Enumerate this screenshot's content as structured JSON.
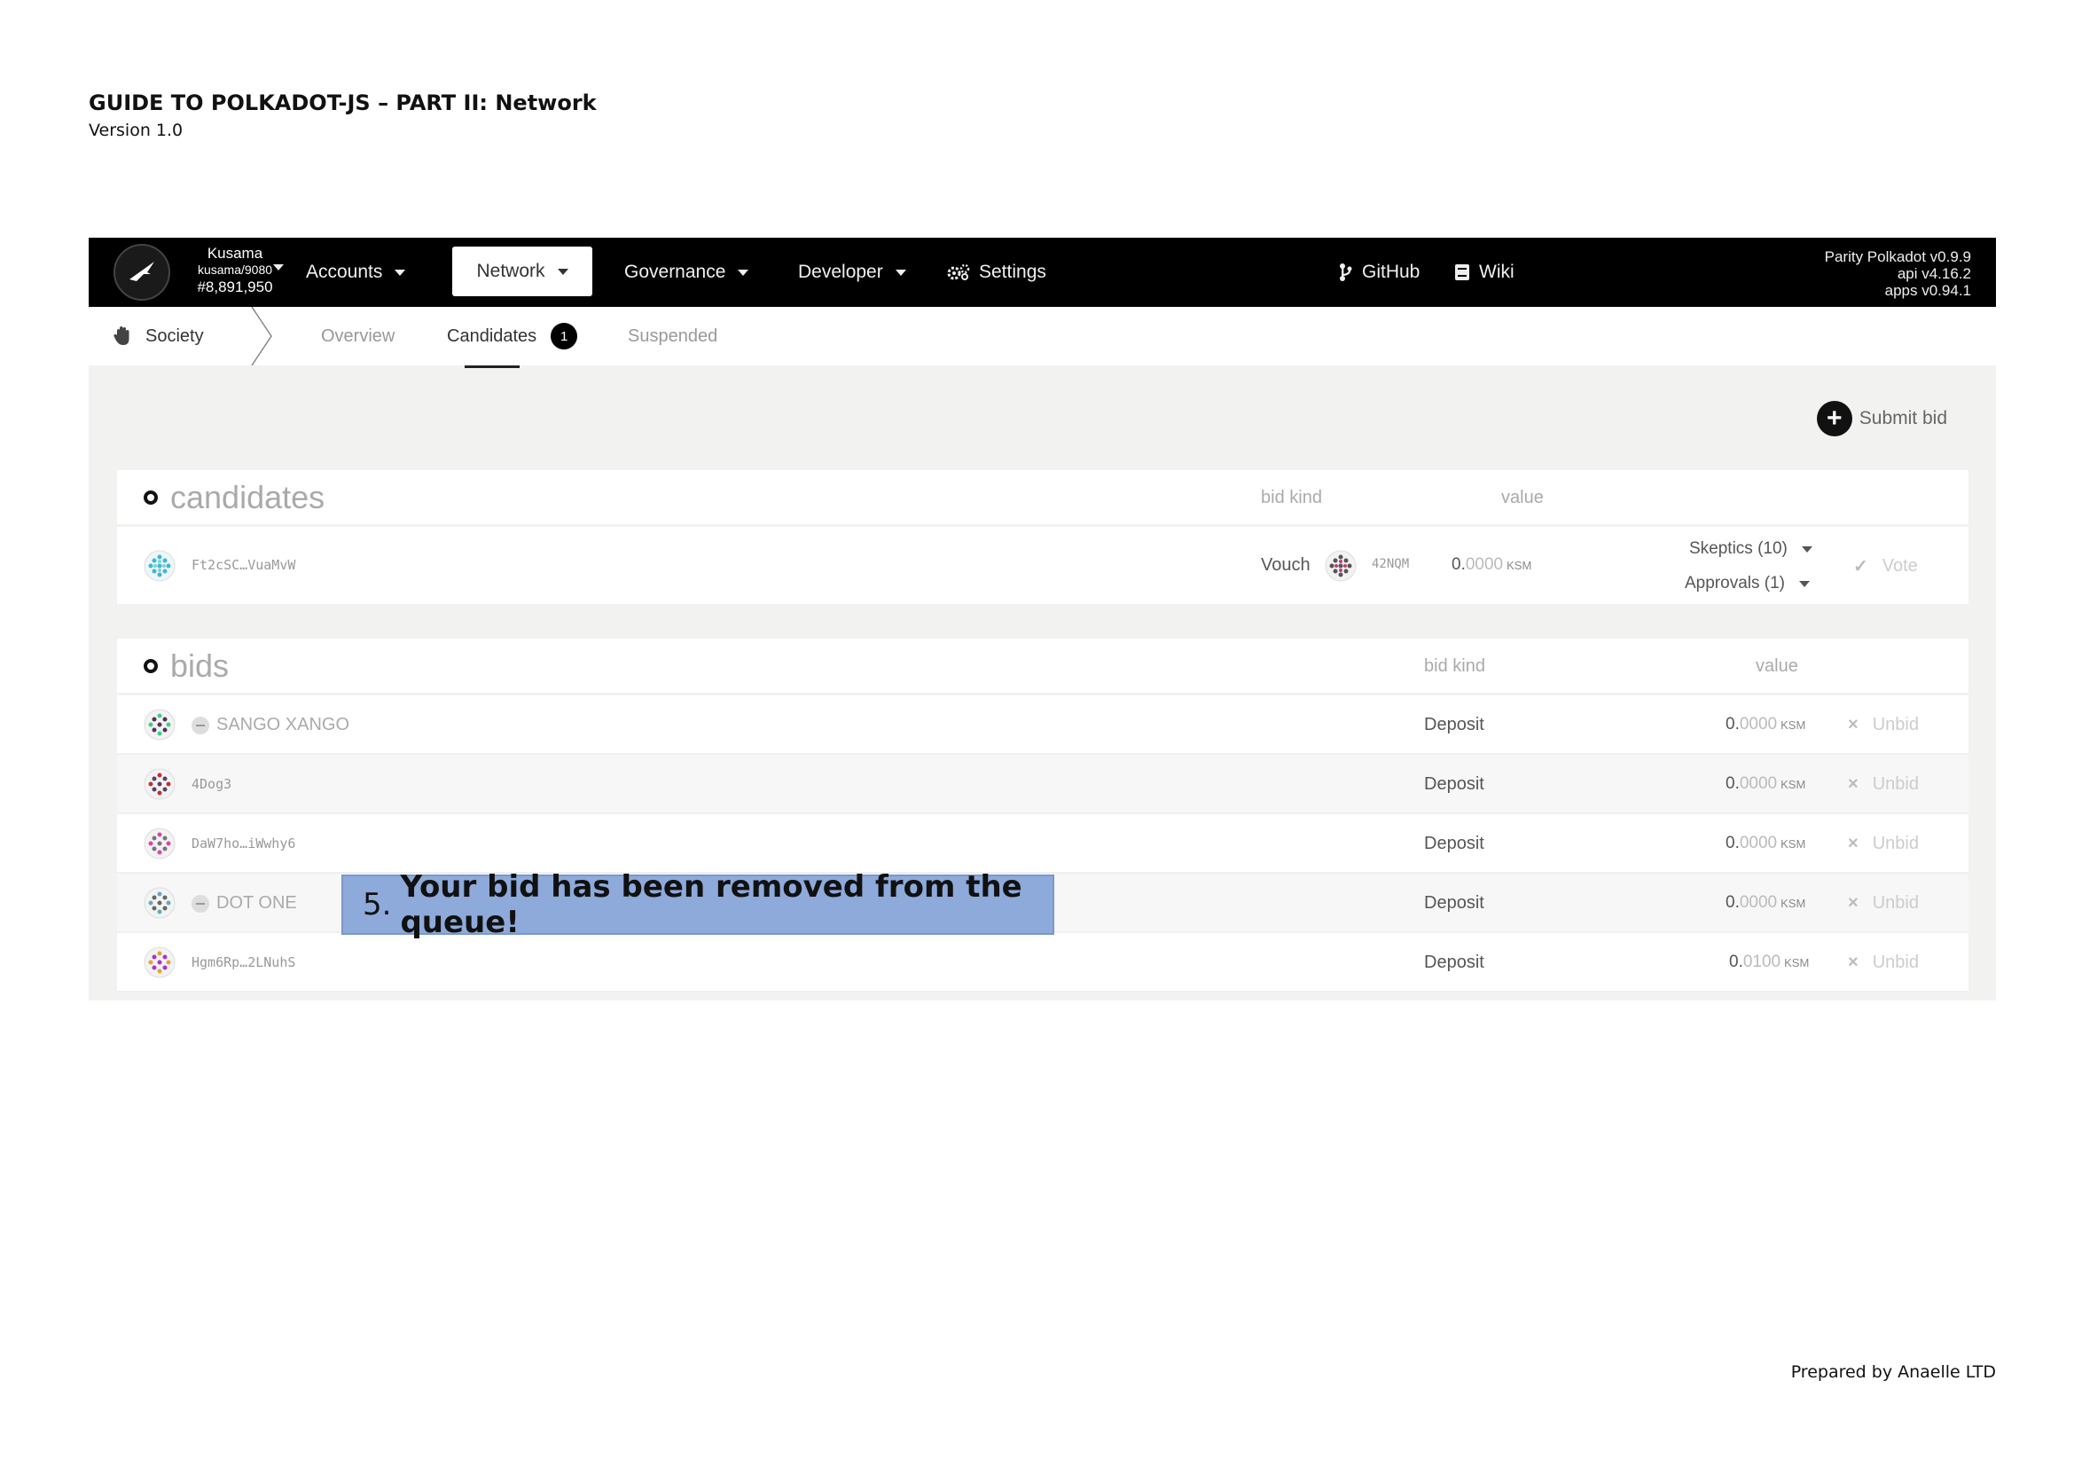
{
  "document": {
    "title": "GUIDE TO POLKADOT-JS – PART II: Network",
    "version": "Version 1.0",
    "footer": "Prepared by Anaelle LTD"
  },
  "topbar": {
    "chain": {
      "name": "Kusama",
      "node": "kusama/9080",
      "block": "#8,891,950"
    },
    "nav": [
      {
        "label": "Accounts",
        "has_caret": true
      },
      {
        "label": "Network",
        "has_caret": true,
        "active": true
      },
      {
        "label": "Governance",
        "has_caret": true
      },
      {
        "label": "Developer",
        "has_caret": true
      },
      {
        "label": "Settings",
        "icon": "gears-icon"
      },
      {
        "label": "GitHub",
        "icon": "branch-icon"
      },
      {
        "label": "Wiki",
        "icon": "book-icon"
      }
    ],
    "versions": [
      "Parity Polkadot v0.9.9",
      "api v4.16.2",
      "apps v0.94.1"
    ]
  },
  "subnav": {
    "section": "Society",
    "tabs": [
      {
        "label": "Overview"
      },
      {
        "label": "Candidates",
        "badge": "1",
        "active": true
      },
      {
        "label": "Suspended"
      }
    ]
  },
  "submit_bid": "Submit bid",
  "candidates": {
    "title": "candidates",
    "col_bid_kind": "bid kind",
    "col_value": "value",
    "rows": [
      {
        "address": "Ft2cSC…VuaMvW",
        "kind": "Vouch",
        "voucher": "42NQM",
        "amount_int": "0.",
        "amount_dec": "0000",
        "unit": "KSM",
        "skeptics": "Skeptics (10)",
        "approvals": "Approvals (1)",
        "action": "Vote"
      }
    ]
  },
  "bids": {
    "title": "bids",
    "col_bid_kind": "bid kind",
    "col_value": "value",
    "rows": [
      {
        "name": "SANGO XANGO",
        "kind": "Deposit",
        "amount_int": "0.",
        "amount_dec": "0000",
        "unit": "KSM",
        "action": "Unbid"
      },
      {
        "address": "4Dog3",
        "kind": "Deposit",
        "amount_int": "0.",
        "amount_dec": "0000",
        "unit": "KSM",
        "action": "Unbid"
      },
      {
        "address": "DaW7ho…iWwhy6",
        "kind": "Deposit",
        "amount_int": "0.",
        "amount_dec": "0000",
        "unit": "KSM",
        "action": "Unbid"
      },
      {
        "name": "DOT ONE",
        "kind": "Deposit",
        "amount_int": "0.",
        "amount_dec": "0000",
        "unit": "KSM",
        "action": "Unbid"
      },
      {
        "address": "Hgm6Rp…2LNuhS",
        "kind": "Deposit",
        "amount_int": "0.",
        "amount_dec": "0100",
        "unit": "KSM",
        "action": "Unbid"
      }
    ]
  },
  "callout": {
    "number": "5.",
    "text": "Your bid has been removed from the queue!"
  },
  "colors": {
    "topbar": "#000000",
    "callout": "#8eaadb",
    "background": "#f2f2f1"
  }
}
